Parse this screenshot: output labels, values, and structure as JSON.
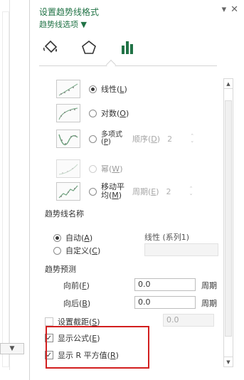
{
  "pane": {
    "title": "设置趋势线格式",
    "subtitle": "趋势线选项 ▼",
    "dropdown_arrow": "▾",
    "close": "✕"
  },
  "tabs": [
    {
      "name": "fill-line-icon"
    },
    {
      "name": "effects-icon"
    },
    {
      "name": "trendline-options-icon"
    }
  ],
  "types": [
    {
      "label": "线性(",
      "key": "L",
      "tail": ")",
      "selected": true
    },
    {
      "label": "对数(",
      "key": "O",
      "tail": ")",
      "selected": false
    },
    {
      "label": "多项式",
      "key": "P",
      "tail": "",
      "selected": false,
      "order_label": "顺序(",
      "order_key": "D",
      "order_tail": ")",
      "order_value": "2"
    },
    {
      "label": "幂(",
      "key": "W",
      "tail": ")",
      "selected": false
    },
    {
      "label": "移动平均(",
      "key": "M",
      "tail": ")",
      "selected": false,
      "period_label": "周期(",
      "period_key": "E",
      "period_tail": ")",
      "period_value": "2"
    }
  ],
  "name_section": {
    "label": "趋势线名称",
    "auto_label": "自动(",
    "auto_key": "A",
    "auto_tail": ")",
    "auto_value": "线性 (系列1)",
    "custom_label": "自定义(",
    "custom_key": "C",
    "custom_tail": ")"
  },
  "forecast": {
    "label": "趋势预测",
    "forward_label": "向前(",
    "forward_key": "F",
    "forward_tail": ")",
    "forward_value": "0.0",
    "backward_label": "向后(",
    "backward_key": "B",
    "backward_tail": ")",
    "backward_value": "0.0",
    "unit": "周期"
  },
  "intercept": {
    "label": "设置截距(",
    "key": "S",
    "tail": ")",
    "value": "0.0",
    "checked": false
  },
  "display_equation": {
    "label": "显示公式(",
    "key": "E",
    "tail": ")",
    "checked": true
  },
  "display_r2": {
    "label": "显示 R 平方值(",
    "key": "R",
    "tail": ")",
    "checked": true
  },
  "colors": {
    "accent": "#217346",
    "highlight": "#d21f1f"
  }
}
